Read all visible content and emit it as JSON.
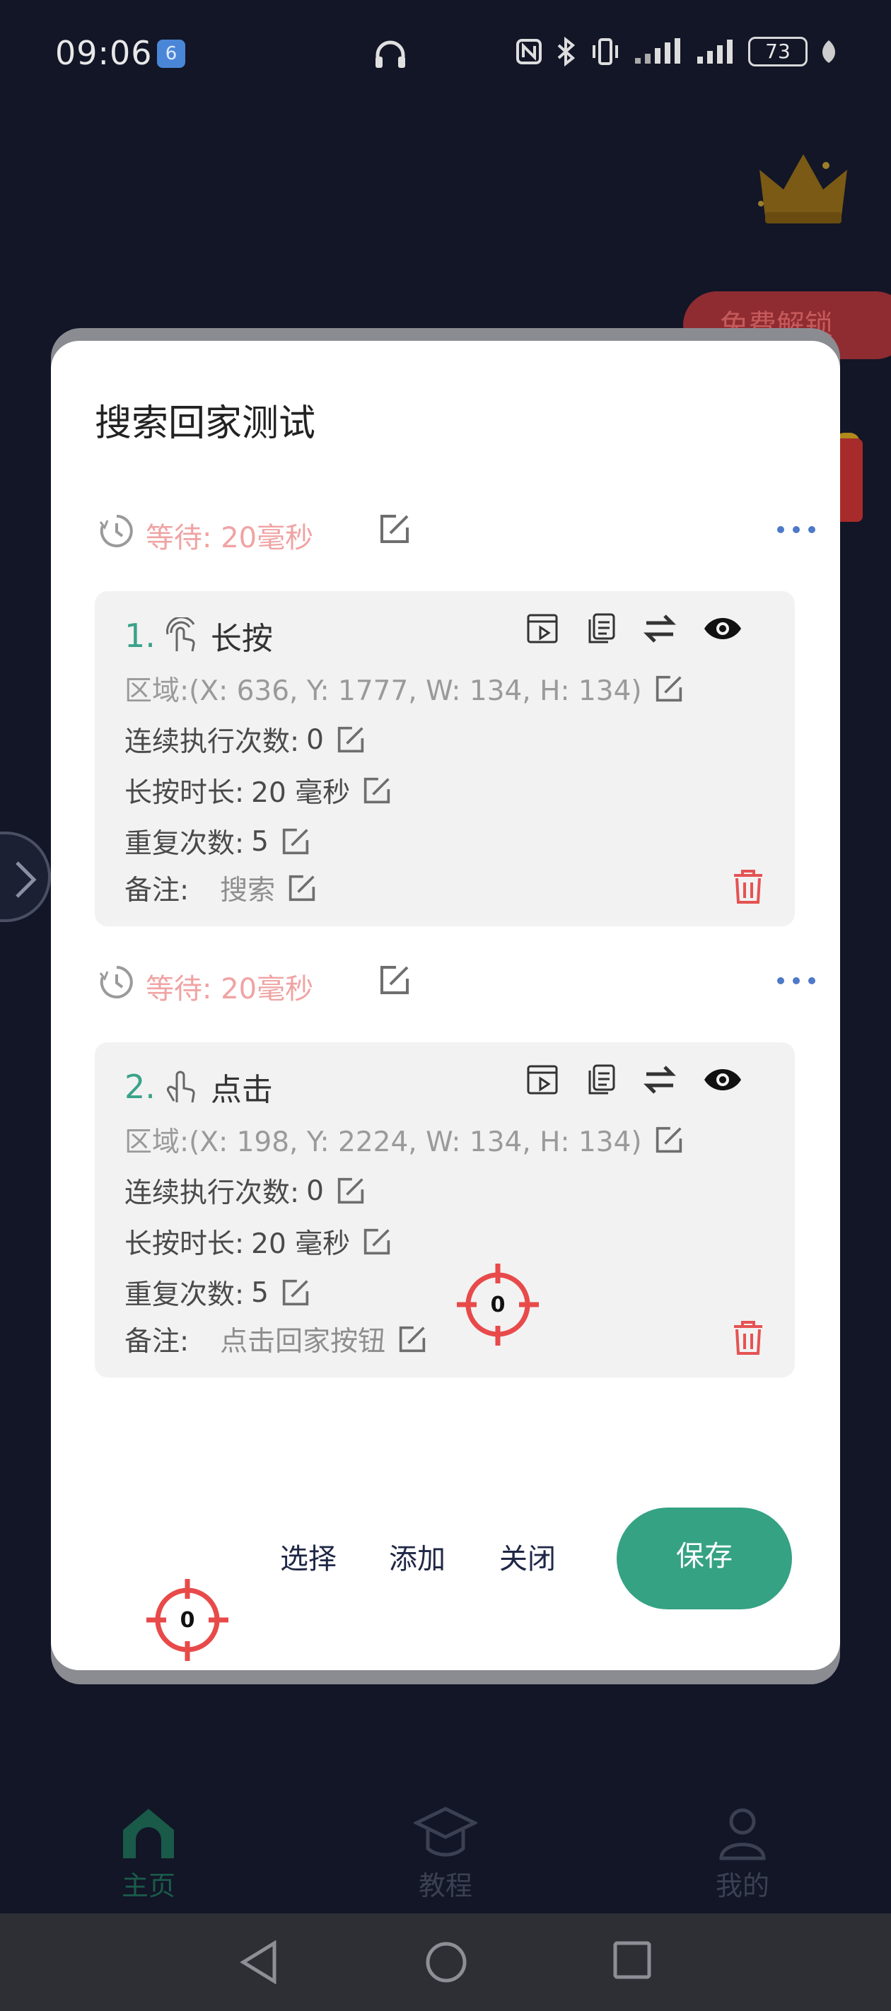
{
  "status_bar": {
    "time": "09:06",
    "app_icon_glyph": "6",
    "battery": "73"
  },
  "background": {
    "unlock_label": "免费解锁",
    "nav": [
      {
        "label": "主页",
        "icon": "home-icon"
      },
      {
        "label": "教程",
        "icon": "graduation-cap-icon"
      },
      {
        "label": "我的",
        "icon": "person-icon"
      }
    ]
  },
  "dialog": {
    "title": "搜索回家测试",
    "waits": [
      {
        "label": "等待: 20毫秒"
      },
      {
        "label": "等待: 20毫秒"
      }
    ],
    "steps": [
      {
        "num": "1.",
        "type": "长按",
        "type_icon": "long-press-finger-icon",
        "region": "区域:(X: 636, Y: 1777, W: 134, H: 134)",
        "exec_label": "连续执行次数:",
        "exec_value": "0",
        "duration_label": "长按时长:",
        "duration_value": "20 毫秒",
        "repeat_label": "重复次数:",
        "repeat_value": "5",
        "note_label": "备注:",
        "note_value": "搜索"
      },
      {
        "num": "2.",
        "type": "点击",
        "type_icon": "tap-finger-icon",
        "region": "区域:(X: 198, Y: 2224, W: 134, H: 134)",
        "exec_label": "连续执行次数:",
        "exec_value": "0",
        "duration_label": "长按时长:",
        "duration_value": "20 毫秒",
        "repeat_label": "重复次数:",
        "repeat_value": "5",
        "note_label": "备注:",
        "note_value": "点击回家按钮"
      }
    ],
    "buttons": {
      "select": "选择",
      "add": "添加",
      "close": "关闭",
      "save": "保存"
    }
  },
  "targets": [
    {
      "label": "0"
    },
    {
      "label": "0"
    }
  ],
  "colors": {
    "accent_green": "#35a283",
    "wait_pink": "#f0a3a3",
    "delete_red": "#e55353",
    "target_red": "#e84a4a"
  }
}
